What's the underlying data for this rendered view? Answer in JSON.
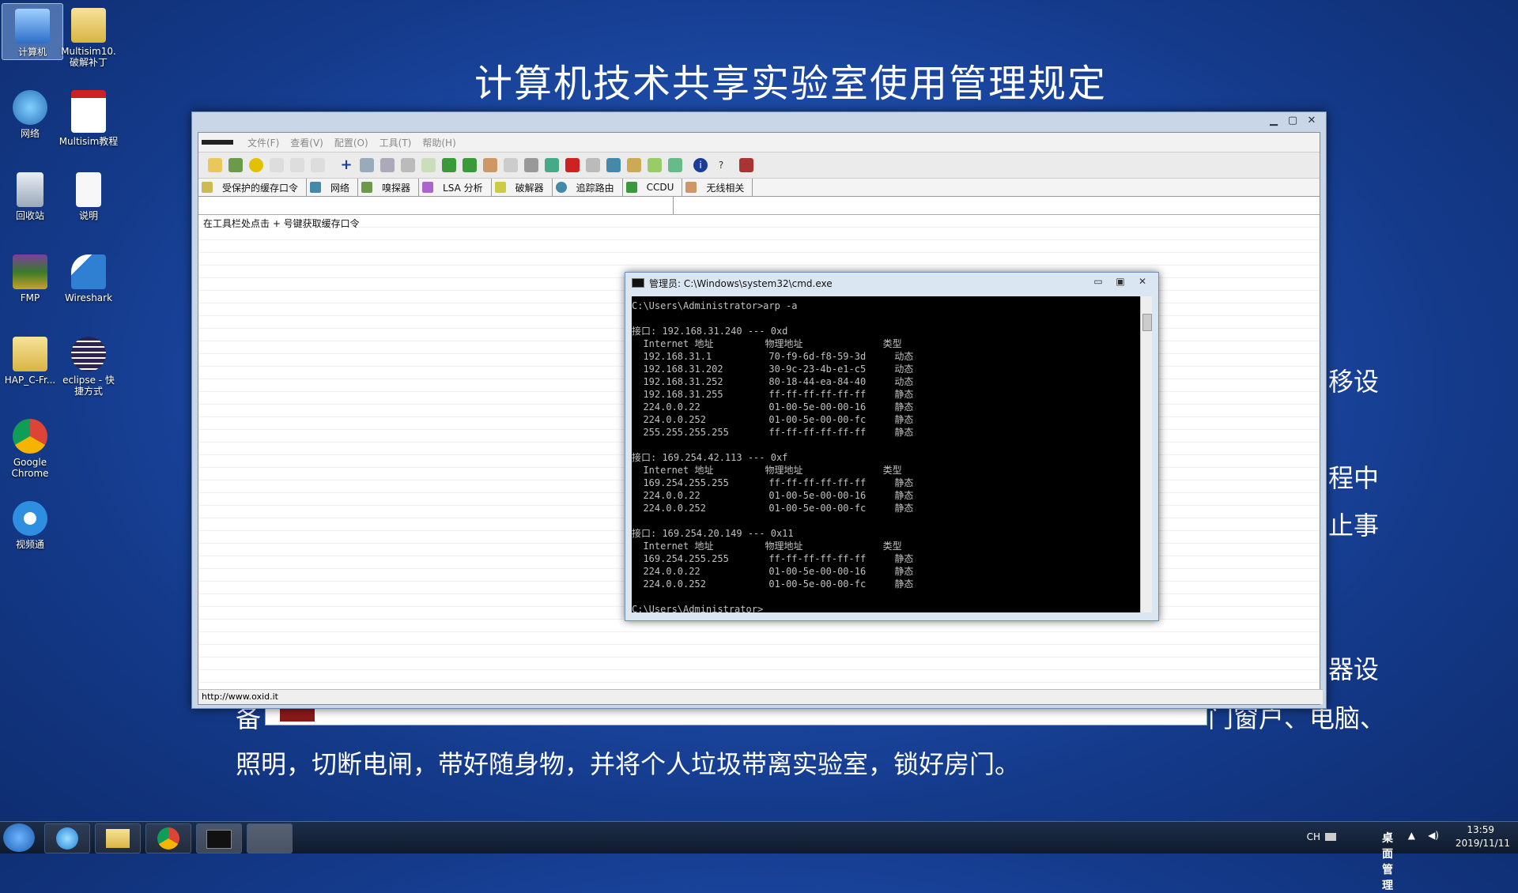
{
  "desktop": {
    "icons": [
      {
        "label": "计算机"
      },
      {
        "label": "Multisim10.破解补丁"
      },
      {
        "label": "网络"
      },
      {
        "label": "Multisim教程"
      },
      {
        "label": "回收站"
      },
      {
        "label": "说明"
      },
      {
        "label": "FMP"
      },
      {
        "label": "Wireshark"
      },
      {
        "label": "HAP_C-Fr..."
      },
      {
        "label": "eclipse - 快捷方式"
      },
      {
        "label": "Google Chrome"
      },
      {
        "label": "视频通"
      }
    ]
  },
  "slide": {
    "title": "计算机技术共享实验室使用管理规定",
    "fragments": [
      "移设",
      "程中",
      "止事",
      "器设",
      "备",
      "门窗户、电脑、"
    ],
    "last_line": "照明，切断电闸，带好随身物，并将个人垃圾带离实验室，锁好房门。"
  },
  "main_window": {
    "menu": [
      "文件(F)",
      "查看(V)",
      "配置(O)",
      "工具(T)",
      "帮助(H)"
    ],
    "tabs": [
      "受保护的缓存口令",
      "网络",
      "嗅探器",
      "LSA 分析",
      "破解器",
      "追踪路由",
      "CCDU",
      "无线相关"
    ],
    "hint": "在工具栏处点击 + 号键获取缓存口令",
    "status": "http://www.oxid.it"
  },
  "cmd": {
    "title": "管理员: C:\\Windows\\system32\\cmd.exe",
    "output": "C:\\Users\\Administrator>arp -a\n\n接口: 192.168.31.240 --- 0xd\n  Internet 地址         物理地址              类型\n  192.168.31.1          70-f9-6d-f8-59-3d     动态\n  192.168.31.202        30-9c-23-4b-e1-c5     动态\n  192.168.31.252        80-18-44-ea-84-40     动态\n  192.168.31.255        ff-ff-ff-ff-ff-ff     静态\n  224.0.0.22            01-00-5e-00-00-16     静态\n  224.0.0.252           01-00-5e-00-00-fc     静态\n  255.255.255.255       ff-ff-ff-ff-ff-ff     静态\n\n接口: 169.254.42.113 --- 0xf\n  Internet 地址         物理地址              类型\n  169.254.255.255       ff-ff-ff-ff-ff-ff     静态\n  224.0.0.22            01-00-5e-00-00-16     静态\n  224.0.0.252           01-00-5e-00-00-fc     静态\n\n接口: 169.254.20.149 --- 0x11\n  Internet 地址         物理地址              类型\n  169.254.255.255       ff-ff-ff-ff-ff-ff     静态\n  224.0.0.22            01-00-5e-00-00-16     静态\n  224.0.0.252           01-00-5e-00-00-fc     静态\n\nC:\\Users\\Administrator>"
  },
  "taskbar": {
    "lang": "CH",
    "desktop_label": "桌面管理",
    "time": "13:59",
    "date": "2019/11/11"
  },
  "colors": {
    "accent": "#1f4fae",
    "cmd_bg": "#000000",
    "cmd_fg": "#c0c0c0"
  }
}
